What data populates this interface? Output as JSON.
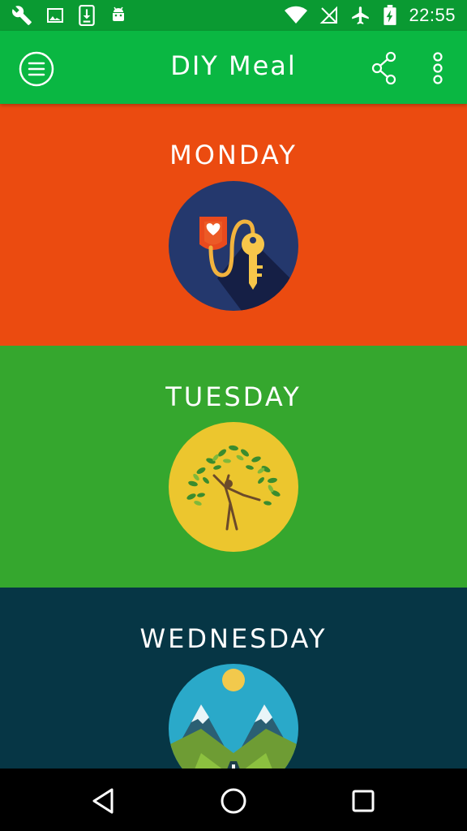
{
  "status_bar": {
    "time": "22:55",
    "left_icons": [
      "wrench-icon",
      "image-icon",
      "download-icon",
      "android-icon"
    ],
    "right_icons": [
      "wifi-icon",
      "no-signal-icon",
      "airplane-icon",
      "battery-charging-icon"
    ]
  },
  "app_bar": {
    "title": "DIY Meal",
    "menu_icon": "menu-icon",
    "share_icon": "share-icon",
    "more_icon": "more-vert-icon",
    "color": "#0ab742"
  },
  "days": [
    {
      "label": "MONDAY",
      "color": "#eb4b10",
      "icon": "heart-key-icon"
    },
    {
      "label": "TUESDAY",
      "color": "#35a72e",
      "icon": "yoga-tree-icon"
    },
    {
      "label": "WEDNESDAY",
      "color": "#063645",
      "icon": "mountain-road-icon"
    }
  ],
  "nav_bar": {
    "back_icon": "back-icon",
    "home_icon": "home-icon",
    "recents_icon": "recents-icon"
  }
}
